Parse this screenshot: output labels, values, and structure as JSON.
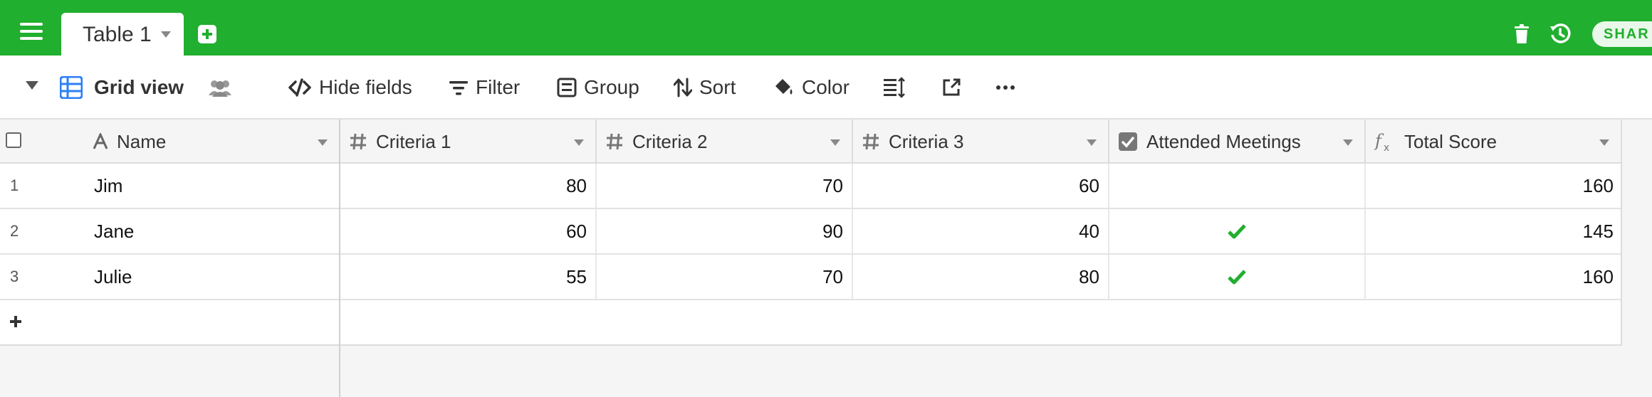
{
  "topbar": {
    "table_tab": "Table 1",
    "share_label": "SHAR",
    "icons": [
      "menu-icon",
      "add-table-icon",
      "trash-icon",
      "history-icon"
    ]
  },
  "toolbar": {
    "view_name": "Grid view",
    "hide_fields": "Hide fields",
    "filter": "Filter",
    "group": "Group",
    "sort": "Sort",
    "color": "Color"
  },
  "columns": [
    {
      "label": "Name",
      "icon": "text-icon"
    },
    {
      "label": "Criteria 1",
      "icon": "number-icon"
    },
    {
      "label": "Criteria 2",
      "icon": "number-icon"
    },
    {
      "label": "Criteria 3",
      "icon": "number-icon"
    },
    {
      "label": "Attended Meetings",
      "icon": "checkbox-icon"
    },
    {
      "label": "Total Score",
      "icon": "formula-icon"
    }
  ],
  "rows": [
    {
      "num": "1",
      "name": "Jim",
      "c1": "80",
      "c2": "70",
      "c3": "60",
      "attended": false,
      "total": "160"
    },
    {
      "num": "2",
      "name": "Jane",
      "c1": "60",
      "c2": "90",
      "c3": "40",
      "attended": true,
      "total": "145"
    },
    {
      "num": "3",
      "name": "Julie",
      "c1": "55",
      "c2": "70",
      "c3": "80",
      "attended": true,
      "total": "160"
    }
  ],
  "colors": {
    "brand": "#20af2e",
    "check": "#20af2e",
    "view_icon": "#2d7ff9"
  }
}
